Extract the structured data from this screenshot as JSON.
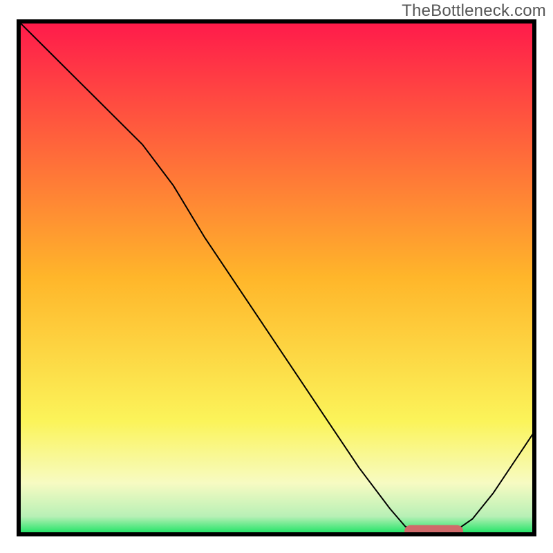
{
  "watermark": "TheBottleneck.com",
  "chart_data": {
    "type": "line",
    "title": "",
    "xlabel": "",
    "ylabel": "",
    "xlim": [
      0,
      100
    ],
    "ylim": [
      0,
      100
    ],
    "grid": false,
    "legend": false,
    "axes_visible": false,
    "background_gradient": {
      "stops": [
        {
          "offset": 0.0,
          "color": "#ff1a4b"
        },
        {
          "offset": 0.5,
          "color": "#ffb62a"
        },
        {
          "offset": 0.78,
          "color": "#fbf45a"
        },
        {
          "offset": 0.9,
          "color": "#f7fbc2"
        },
        {
          "offset": 0.965,
          "color": "#b8f0b6"
        },
        {
          "offset": 1.0,
          "color": "#14e360"
        }
      ]
    },
    "curve": {
      "name": "bottleneck-curve",
      "color": "#000000",
      "stroke_width": 2,
      "x": [
        0,
        6,
        12,
        18,
        24,
        30,
        36,
        42,
        48,
        54,
        60,
        66,
        72,
        75,
        78,
        81,
        84,
        88,
        92,
        96,
        100
      ],
      "y": [
        100,
        94,
        88,
        82,
        76,
        68,
        58,
        49,
        40,
        31,
        22,
        13,
        5,
        1.5,
        0.4,
        0.2,
        0.2,
        3,
        8,
        14,
        20
      ]
    },
    "marker": {
      "name": "optimal-range",
      "x_start": 76,
      "x_end": 85,
      "y": 0.6,
      "color": "#d06a6a",
      "thickness": 2.4
    }
  },
  "frame": {
    "stroke": "#000000",
    "stroke_width": 6
  }
}
